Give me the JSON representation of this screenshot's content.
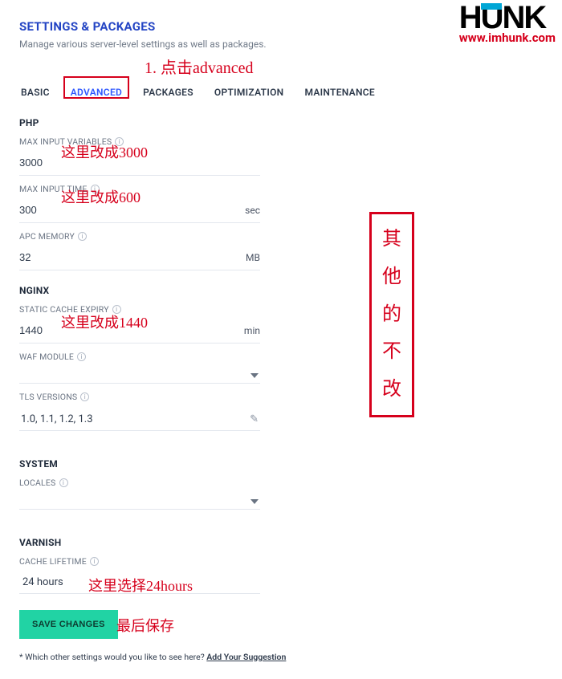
{
  "header": {
    "title": "SETTINGS & PACKAGES",
    "subtitle": "Manage various server-level settings as well as packages."
  },
  "tabs": {
    "items": [
      "BASIC",
      "ADVANCED",
      "PACKAGES",
      "OPTIMIZATION",
      "MAINTENANCE"
    ],
    "active_index": 1
  },
  "php": {
    "title": "PHP",
    "max_input_vars": {
      "label": "MAX INPUT VARIABLES",
      "value": "3000"
    },
    "max_input_time": {
      "label": "MAX INPUT TIME",
      "value": "300",
      "unit": "sec"
    },
    "apc_memory": {
      "label": "APC MEMORY",
      "value": "32",
      "unit": "MB"
    }
  },
  "nginx": {
    "title": "NGINX",
    "static_cache": {
      "label": "STATIC CACHE EXPIRY",
      "value": "1440",
      "unit": "min"
    },
    "waf": {
      "label": "WAF MODULE",
      "value": ""
    },
    "tls": {
      "label": "TLS VERSIONS",
      "value": "1.0, 1.1, 1.2, 1.3"
    }
  },
  "system": {
    "title": "SYSTEM",
    "locales": {
      "label": "LOCALES",
      "value": ""
    }
  },
  "varnish": {
    "title": "VARNISH",
    "cache_lifetime": {
      "label": "CACHE LIFETIME",
      "value": "24 hours"
    }
  },
  "actions": {
    "save": "SAVE CHANGES"
  },
  "footer": {
    "prefix": "* Which other settings would you like to see here? ",
    "link": "Add Your Suggestion"
  },
  "logo": {
    "text": "HUNK",
    "url": "www.imhunk.com"
  },
  "annotations": {
    "step1": "1. 点击advanced",
    "vars": "这里改成3000",
    "time": "这里改成600",
    "cache": "这里改成1440",
    "varnish": "这里选择24hours",
    "save": "最后保存",
    "sidebox": [
      "其",
      "他",
      "的",
      "不",
      "改"
    ]
  }
}
